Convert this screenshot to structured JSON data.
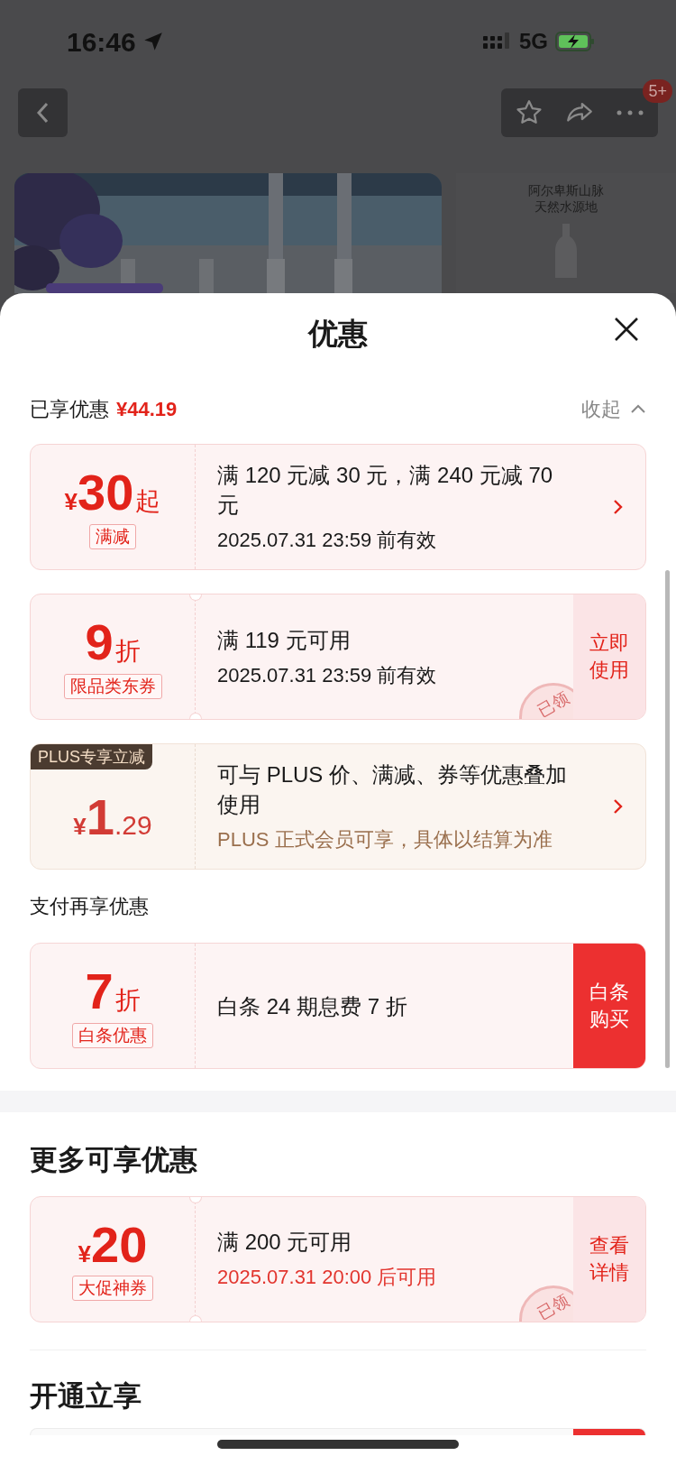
{
  "status_bar": {
    "time": "16:46",
    "network": "5G"
  },
  "nav": {
    "badge": "5+"
  },
  "banner": {
    "side_text": [
      "阿尔卑斯山脉",
      "天然水源地"
    ]
  },
  "sheet": {
    "title": "优惠",
    "saved": {
      "label": "已享优惠",
      "amount": "¥44.19",
      "toggle": "收起"
    },
    "coupons": [
      {
        "kind": "coupon",
        "currency": "¥",
        "value": "30",
        "suffix": "起",
        "tag": "满减",
        "desc": "满 120 元减 30 元，满 240 元减 70 元",
        "validity": "2025.07.31 23:59 前有效",
        "notched": false
      },
      {
        "kind": "coupon",
        "value": "9",
        "suffix": "折",
        "tag": "限品类东券",
        "desc": "满 119 元可用",
        "validity": "2025.07.31 23:59 前有效",
        "notched": true,
        "action": "立即使用",
        "stamp": "已领"
      },
      {
        "kind": "plus",
        "badge": "PLUS专享立减",
        "currency": "¥",
        "value": "1",
        "decimals": ".29",
        "desc": "可与 PLUS 价、满减、券等优惠叠加使用",
        "validity": "PLUS 正式会员可享，具体以结算为准",
        "notched": false
      }
    ],
    "pay": {
      "title": "支付再享优惠",
      "coupons": [
        {
          "kind": "payment",
          "value": "7",
          "suffix": "折",
          "tag": "白条优惠",
          "desc": "白条 24 期息费 7 折",
          "notched": false,
          "action": "白条购买"
        }
      ]
    },
    "more": {
      "title": "更多可享优惠",
      "coupons": [
        {
          "kind": "coupon",
          "currency": "¥",
          "value": "20",
          "tag": "大促神券",
          "desc": "满 200 元可用",
          "validity": "2025.07.31 20:00 后可用",
          "validity_alert": true,
          "notched": true,
          "action": "查看详情",
          "stamp": "已领"
        }
      ]
    },
    "open": {
      "title": "开通立享"
    }
  }
}
